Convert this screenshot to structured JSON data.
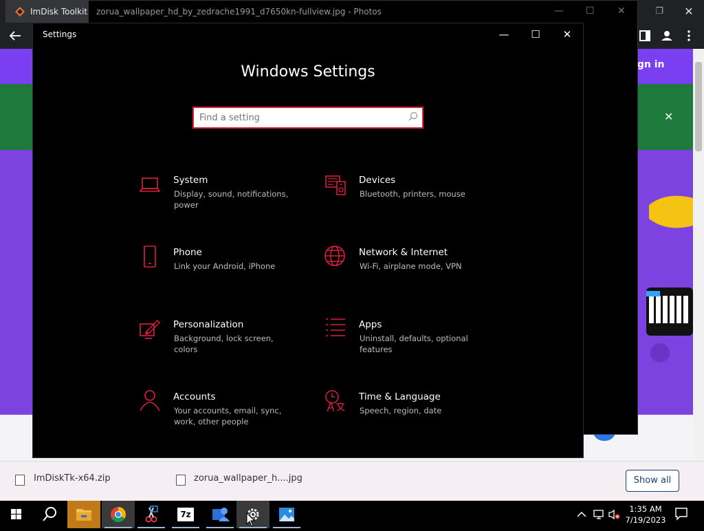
{
  "browser": {
    "tab_title": "ImDisk Toolkit d",
    "signin": "Sign in",
    "close_glyph": "✕",
    "downloads": [
      {
        "name": "ImDiskTk-x64.zip"
      },
      {
        "name": "zorua_wallpaper_h....jpg"
      }
    ],
    "show_all": "Show all"
  },
  "photos": {
    "title": "zorua_wallpaper_hd_by_zedrache1991_d7650kn-fullview.jpg - Photos"
  },
  "settings": {
    "window_title": "Settings",
    "heading": "Windows Settings",
    "search_placeholder": "Find a setting",
    "accent": "#e01e3c",
    "tiles": [
      {
        "title": "System",
        "desc": "Display, sound, notifications, power",
        "icon": "laptop-icon"
      },
      {
        "title": "Devices",
        "desc": "Bluetooth, printers, mouse",
        "icon": "devices-icon"
      },
      {
        "title": "Phone",
        "desc": "Link your Android, iPhone",
        "icon": "phone-icon"
      },
      {
        "title": "Network & Internet",
        "desc": "Wi-Fi, airplane mode, VPN",
        "icon": "globe-icon"
      },
      {
        "title": "Personalization",
        "desc": "Background, lock screen, colors",
        "icon": "paintbrush-icon"
      },
      {
        "title": "Apps",
        "desc": "Uninstall, defaults, optional features",
        "icon": "apps-list-icon"
      },
      {
        "title": "Accounts",
        "desc": "Your accounts, email, sync, work, other people",
        "icon": "person-icon"
      },
      {
        "title": "Time & Language",
        "desc": "Speech, region, date",
        "icon": "time-language-icon"
      }
    ]
  },
  "taskbar": {
    "apps": [
      "start-icon",
      "search-icon",
      "file-explorer-icon",
      "chrome-icon",
      "snipping-tool-icon",
      "7zip-icon",
      "people-app-icon",
      "settings-gear-icon",
      "photos-app-icon"
    ],
    "seven_zip_label": "7z",
    "time": "1:35 AM",
    "date": "7/19/2023"
  }
}
